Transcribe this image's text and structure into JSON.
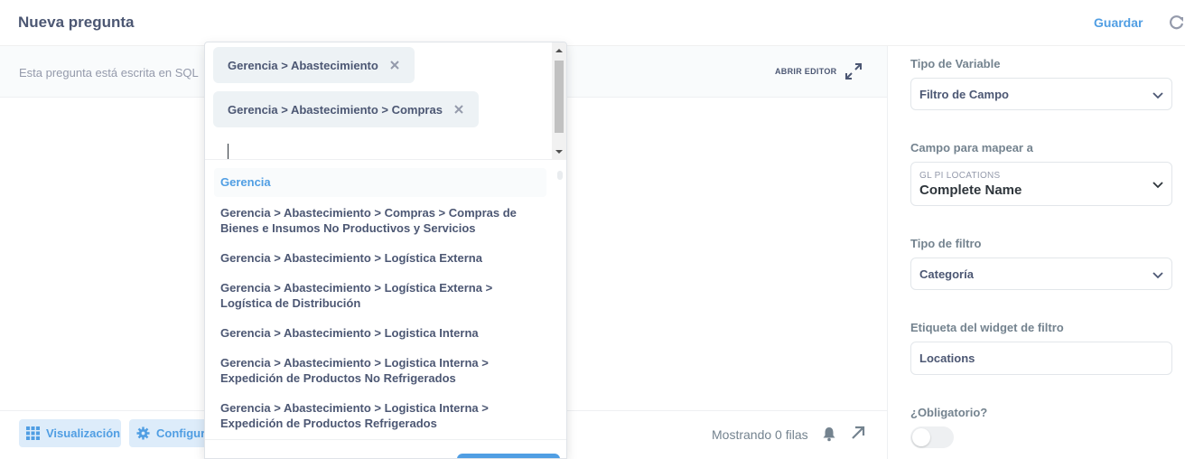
{
  "header": {
    "title": "Nueva pregunta",
    "save_label": "Guardar"
  },
  "sql_bar": {
    "text": "Esta pregunta está escrita en SQL",
    "open_editor_label": "ABRIR EDITOR"
  },
  "bottom_bar": {
    "visualization_label": "Visualización",
    "settings_label": "Configura",
    "rows_text": "Mostrando 0 filas"
  },
  "sidebar": {
    "variable_type_label": "Tipo de Variable",
    "variable_type_value": "Filtro de Campo",
    "map_field_label": "Campo para mapear a",
    "map_field_table": "GL PI LOCATIONS",
    "map_field_value": "Complete Name",
    "filter_type_label": "Tipo de filtro",
    "filter_type_value": "Categoría",
    "widget_label_label": "Etiqueta del widget de filtro",
    "widget_label_value": "Locations",
    "required_label": "¿Obligatorio?",
    "required_value": false
  },
  "dropdown": {
    "selected_tags": [
      "Gerencia > Abastecimiento",
      "Gerencia > Abastecimiento > Compras"
    ],
    "options": [
      "Gerencia",
      "Gerencia > Abastecimiento > Compras > Compras de Bienes e Insumos No Productivos y Servicios",
      "Gerencia > Abastecimiento > Logística Externa",
      "Gerencia > Abastecimiento > Logística Externa > Logística de Distribución",
      "Gerencia > Abastecimiento > Logistica Interna",
      "Gerencia > Abastecimiento > Logistica Interna > Expedición de Productos No Refrigerados",
      "Gerencia > Abastecimiento > Logistica Interna > Expedición de Productos Refrigerados"
    ],
    "options_display": [
      [
        "Gerencia"
      ],
      [
        "Gerencia > Abastecimiento > Compras > Compras de",
        "Bienes e Insumos No Productivos y Servicios"
      ],
      [
        "Gerencia > Abastecimiento > Logística Externa"
      ],
      [
        "Gerencia > Abastecimiento > Logística Externa >",
        "Logística de Distribución"
      ],
      [
        "Gerencia > Abastecimiento > Logistica Interna"
      ],
      [
        "Gerencia > Abastecimiento > Logistica Interna >",
        "Expedición de Productos No Refrigerados"
      ],
      [
        "Gerencia > Abastecimiento > Logistica Interna >",
        "Expedición de Productos Refrigerados"
      ]
    ]
  },
  "colors": {
    "brand": "#509ee3",
    "text": "#4c5773",
    "muted": "#949aab"
  }
}
